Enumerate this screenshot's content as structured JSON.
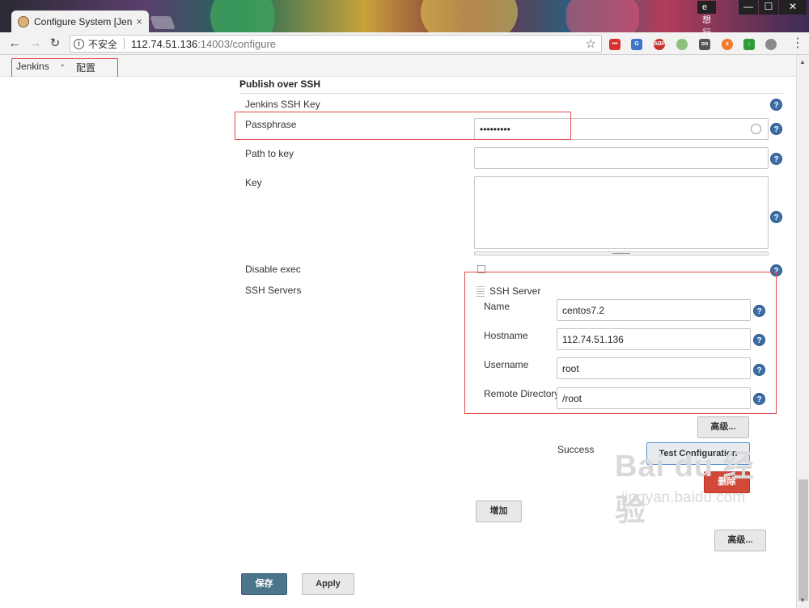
{
  "browser": {
    "tab_title": "Configure System [Jenk",
    "tab_close": "×",
    "user_badge": "e想行空",
    "win_min": "—",
    "win_max": "☐",
    "win_close": "✕",
    "security_label": "不安全",
    "url_host": "112.74.51.136",
    "url_rest": ":14003/configure",
    "back_glyph": "←",
    "forward_glyph": "→",
    "reload_glyph": "↻",
    "star_glyph": "☆",
    "menu_glyph": "⋮",
    "extensions": [
      "red-ext-icon",
      "translate-ext-icon",
      "abp-ext-icon",
      "green-circle-ext-icon",
      "bracket-ext-icon",
      "orange-ext-icon",
      "green-square-ext-icon",
      "cloud-ext-icon"
    ],
    "ext_abp_text": "ABP"
  },
  "breadcrumbs": {
    "root": "Jenkins",
    "arrow": "▸",
    "current": "配置"
  },
  "section": {
    "title": "Publish over SSH",
    "ssh_key_label": "Jenkins SSH Key",
    "passphrase_label": "Passphrase",
    "passphrase_value": "•••••••••",
    "path_to_key_label": "Path to key",
    "path_to_key_value": "",
    "key_label": "Key",
    "disable_exec_label": "Disable exec",
    "ssh_servers_label": "SSH Servers",
    "help_glyph": "?"
  },
  "ssh_server": {
    "title": "SSH Server",
    "name_label": "Name",
    "name_value": "centos7.2",
    "hostname_label": "Hostname",
    "hostname_value": "112.74.51.136",
    "username_label": "Username",
    "username_value": "root",
    "remote_dir_label": "Remote Directory",
    "remote_dir_value": "/root",
    "advanced_button": "高级...",
    "status_text": "Success",
    "test_button": "Test Configuration",
    "delete_button": "删除"
  },
  "actions": {
    "add_button": "增加",
    "advanced_button": "高级...",
    "save_button": "保存",
    "apply_button": "Apply"
  },
  "watermark": {
    "brand": "Bai du 经验",
    "url": "jingyan.baidu.com"
  },
  "colors": {
    "annotation": "#e04b4b",
    "delete": "#d24939",
    "save": "#4b758b",
    "help": "#3a6ea8"
  }
}
